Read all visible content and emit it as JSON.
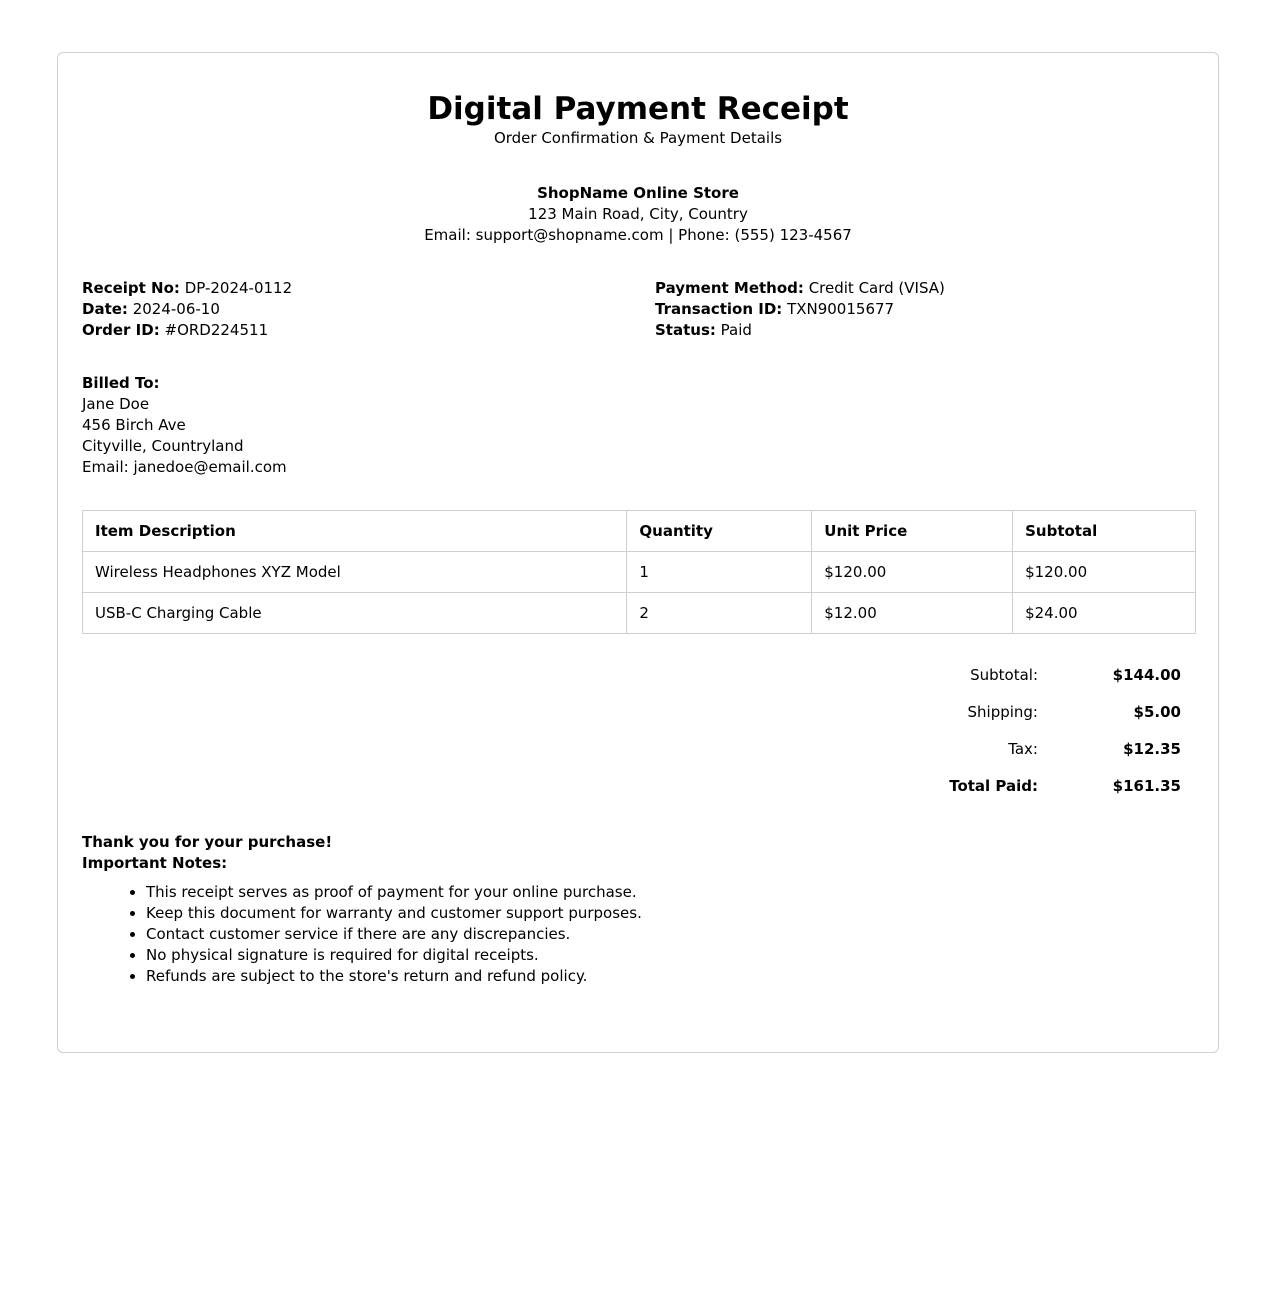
{
  "header": {
    "title": "Digital Payment Receipt",
    "subtitle": "Order Confirmation & Payment Details"
  },
  "store": {
    "name": "ShopName Online Store",
    "address": "123 Main Road, City, Country",
    "contact": "Email: support@shopname.com | Phone: (555) 123-4567"
  },
  "meta": {
    "receipt_no_label": "Receipt No:",
    "receipt_no": "DP-2024-0112",
    "date_label": "Date:",
    "date": "2024-06-10",
    "order_id_label": "Order ID:",
    "order_id": "#ORD224511",
    "payment_method_label": "Payment Method:",
    "payment_method": "Credit Card (VISA)",
    "transaction_id_label": "Transaction ID:",
    "transaction_id": "TXN90015677",
    "status_label": "Status:",
    "status": "Paid"
  },
  "billed": {
    "heading": "Billed To:",
    "name": "Jane Doe",
    "street": "456 Birch Ave",
    "city": "Cityville, Countryland",
    "email": "Email: janedoe@email.com"
  },
  "items": {
    "headers": [
      "Item Description",
      "Quantity",
      "Unit Price",
      "Subtotal"
    ],
    "rows": [
      [
        "Wireless Headphones XYZ Model",
        "1",
        "$120.00",
        "$120.00"
      ],
      [
        "USB-C Charging Cable",
        "2",
        "$12.00",
        "$24.00"
      ]
    ]
  },
  "totals": {
    "subtotal_label": "Subtotal:",
    "subtotal": "$144.00",
    "shipping_label": "Shipping:",
    "shipping": "$5.00",
    "tax_label": "Tax:",
    "tax": "$12.35",
    "total_label": "Total Paid:",
    "total": "$161.35"
  },
  "footer": {
    "thanks": "Thank you for your purchase!",
    "notes_heading": "Important Notes:",
    "notes": [
      "This receipt serves as proof of payment for your online purchase.",
      "Keep this document for warranty and customer support purposes.",
      "Contact customer service if there are any discrepancies.",
      "No physical signature is required for digital receipts.",
      "Refunds are subject to the store's return and refund policy."
    ]
  }
}
